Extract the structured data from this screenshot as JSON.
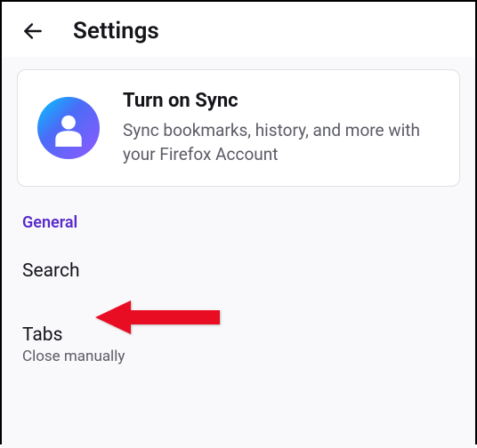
{
  "header": {
    "title": "Settings"
  },
  "sync_card": {
    "title": "Turn on Sync",
    "description": "Sync bookmarks, history, and more with your Firefox Account"
  },
  "sections": {
    "general": {
      "label": "General",
      "items": [
        {
          "title": "Search",
          "subtitle": ""
        },
        {
          "title": "Tabs",
          "subtitle": "Close manually"
        }
      ]
    }
  }
}
